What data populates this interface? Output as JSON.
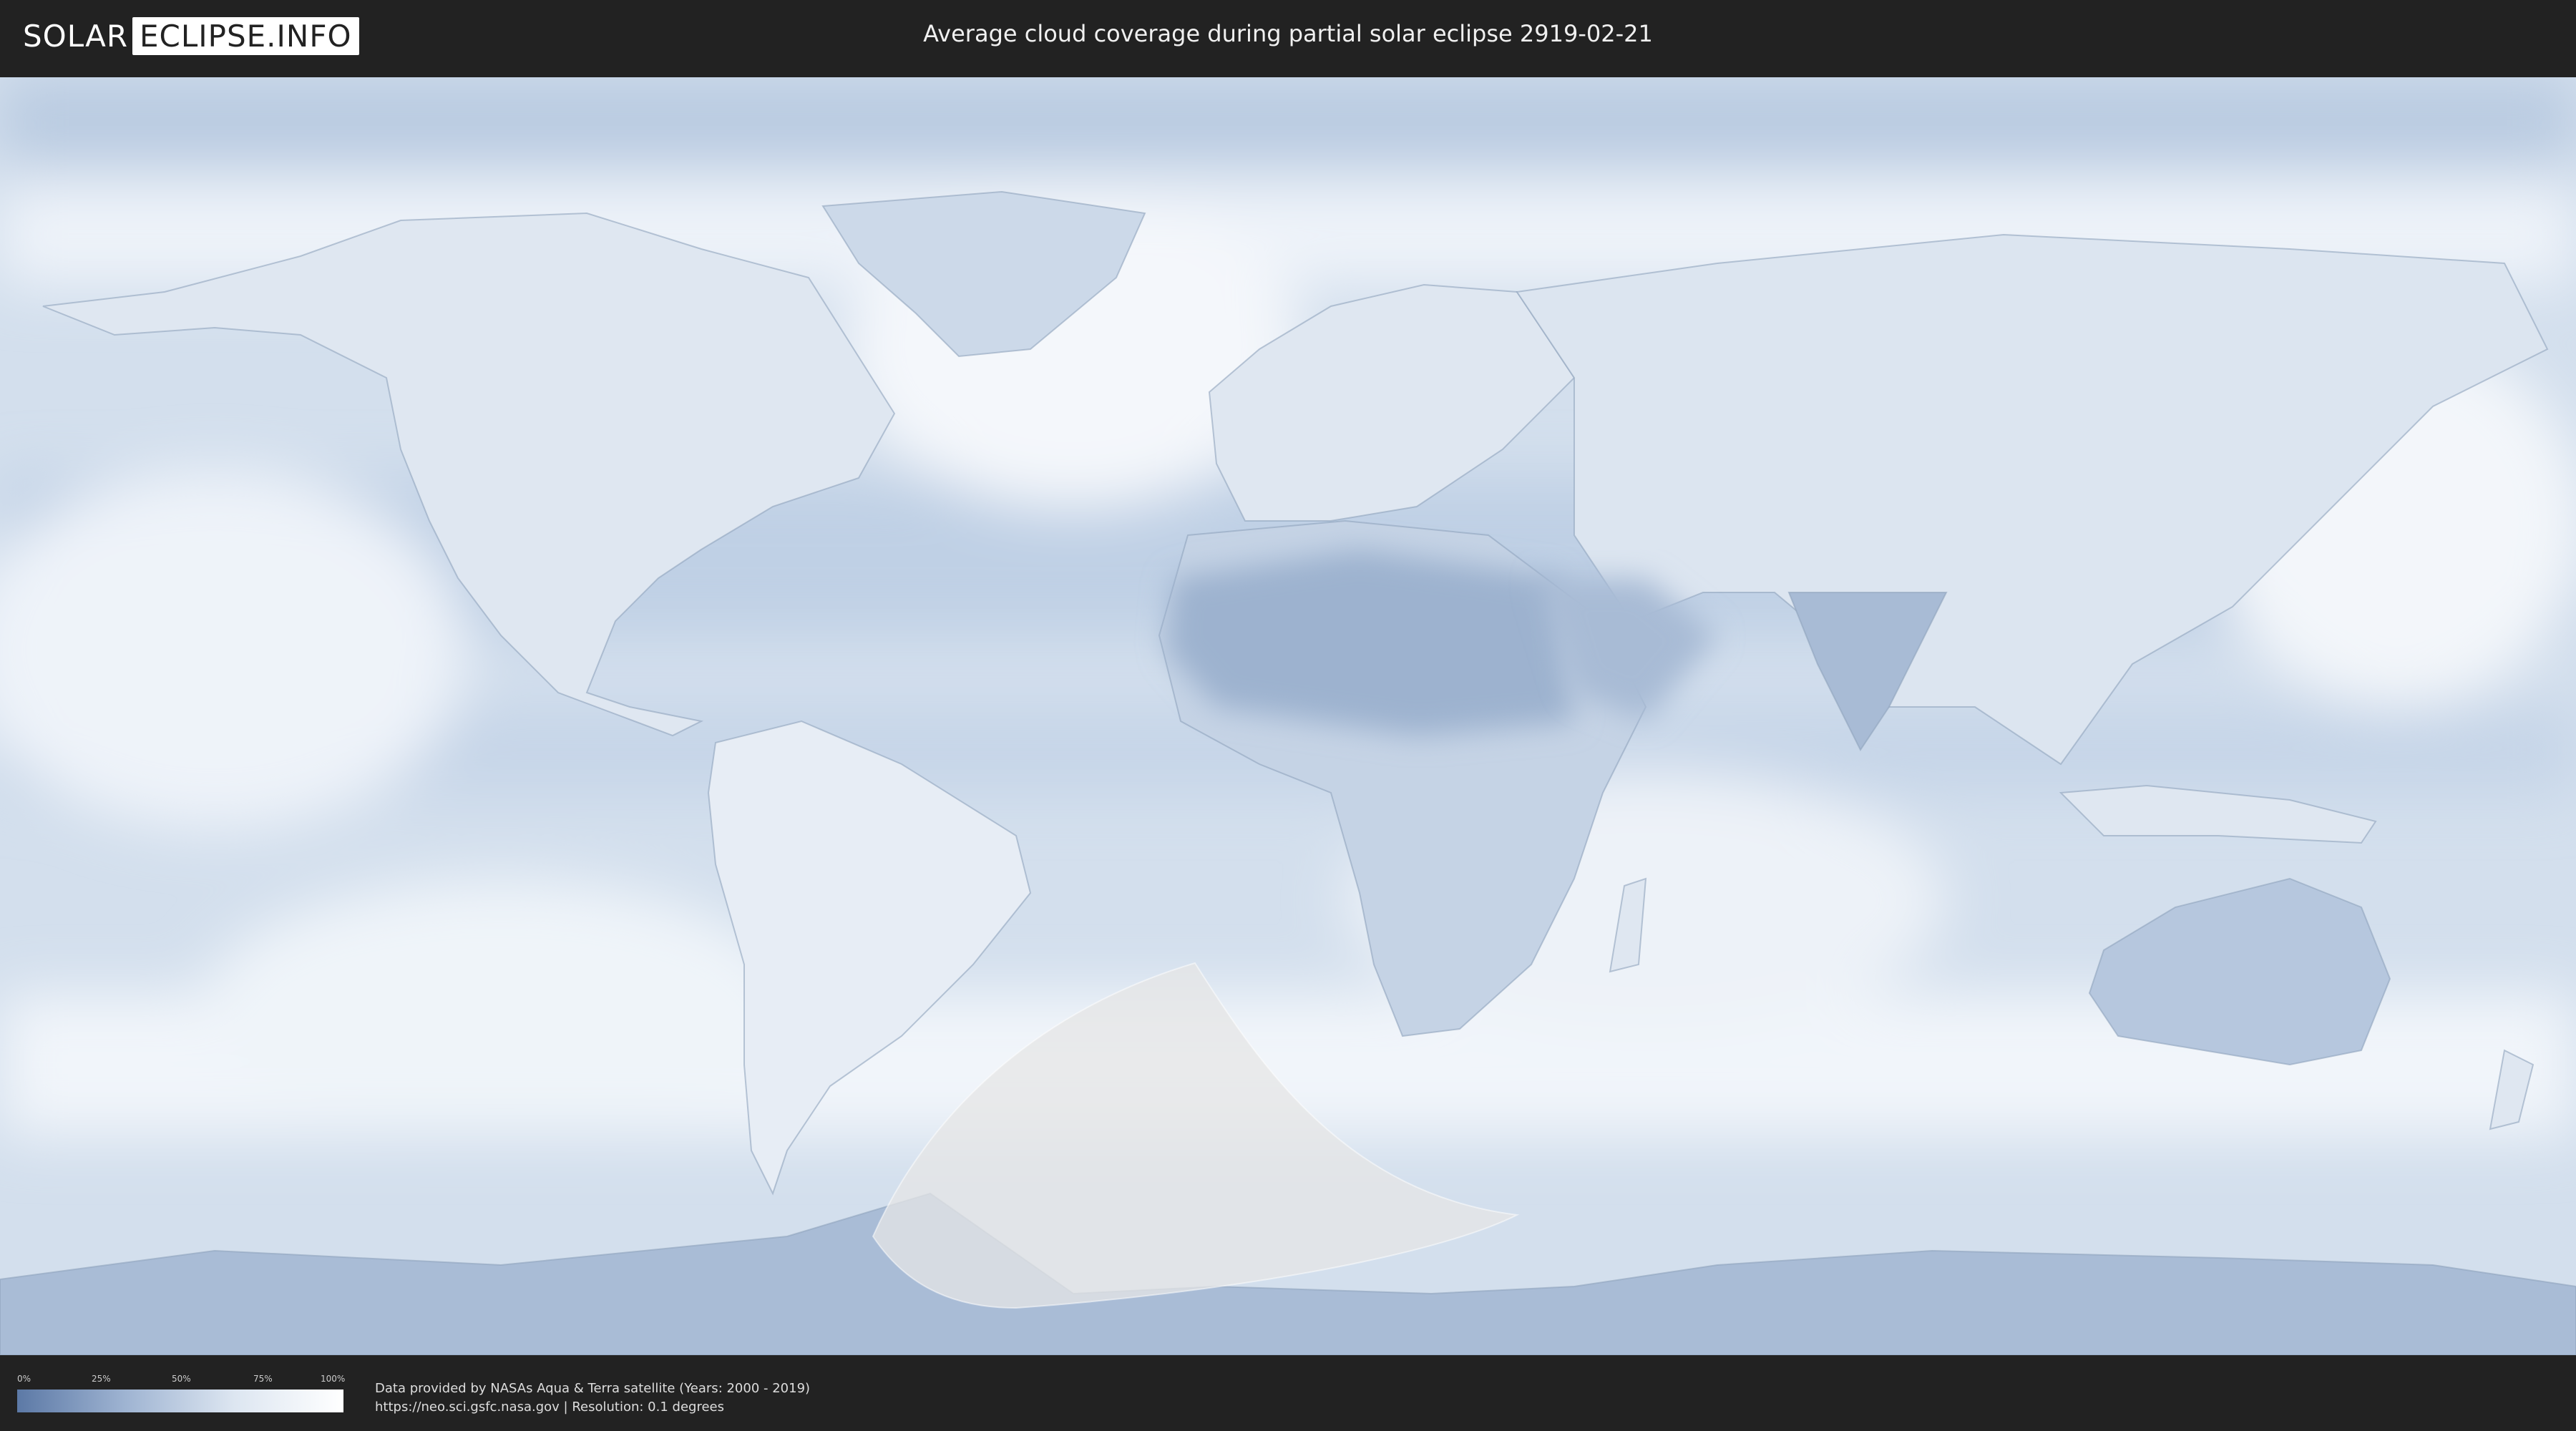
{
  "header": {
    "logo_part1": "SOLAR",
    "logo_part2": "ECLIPSE.INFO",
    "title": "Average cloud coverage during partial solar eclipse 2919-02-21"
  },
  "map": {
    "icons": [
      "world-map",
      "continent-outlines",
      "eclipse-visibility-zone"
    ],
    "colors": {
      "clear_sky": "#5c79a6",
      "full_cloud": "#ffffff",
      "ocean_base": "#cfdcec",
      "eclipse_zone": "#e4e4e4"
    }
  },
  "legend": {
    "ticks": [
      "0%",
      "25%",
      "50%",
      "75%",
      "100%"
    ]
  },
  "credits": {
    "line1": "Data provided by NASAs Aqua & Terra satellite (Years: 2000 - 2019)",
    "line2": "https://neo.sci.gsfc.nasa.gov | Resolution: 0.1 degrees"
  }
}
